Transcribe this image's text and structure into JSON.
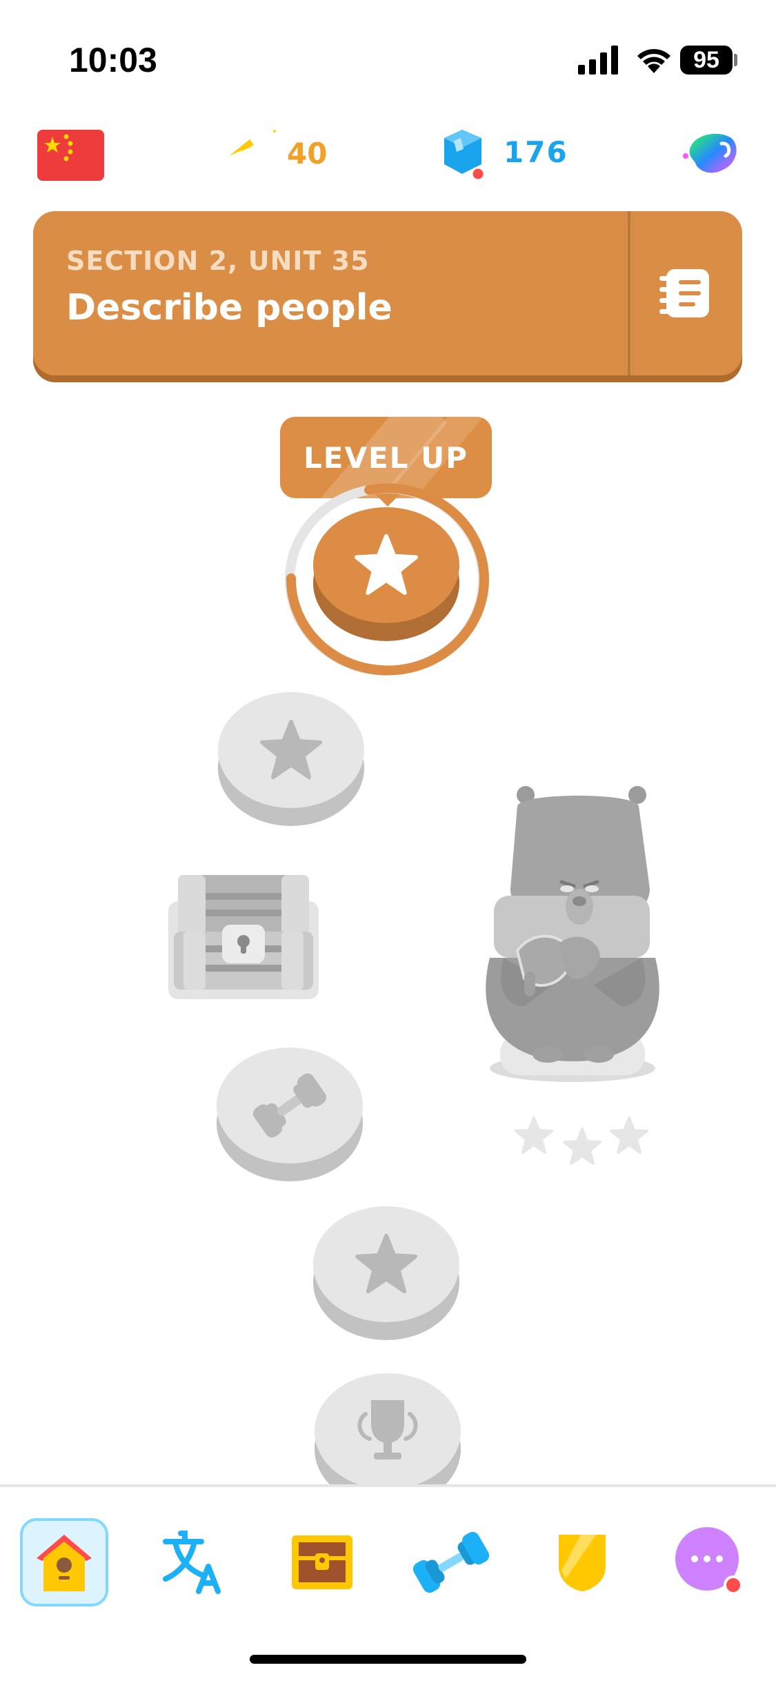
{
  "status_bar": {
    "time": "10:03",
    "battery": "95"
  },
  "top_bar": {
    "streak": "40",
    "gems": "176"
  },
  "unit": {
    "section_label": "SECTION 2, UNIT 35",
    "title": "Describe people"
  },
  "path": {
    "tooltip": "LEVEL UP"
  },
  "colors": {
    "unit_accent": "#da8d44",
    "locked": "#e6e6e6",
    "gem": "#1ba4ee",
    "streak": "#f2a126"
  },
  "nav": {
    "items": [
      {
        "icon": "home-icon"
      },
      {
        "icon": "translate-icon"
      },
      {
        "icon": "treasure-chest-icon"
      },
      {
        "icon": "dumbbell-icon"
      },
      {
        "icon": "shield-icon"
      },
      {
        "icon": "more-icon"
      }
    ]
  }
}
